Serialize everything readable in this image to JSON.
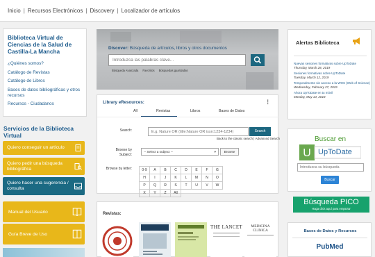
{
  "topnav": {
    "items": [
      "Inicio",
      "Recursos Electrónicos",
      "Discovery",
      "Localizador de artículos"
    ],
    "separator": "|"
  },
  "left": {
    "title": "Biblioteca Virtual de Ciencias de la Salud de Castilla-La Mancha",
    "links": [
      "¿Quiénes somos?",
      "Catálogo de Revistas",
      "Catálogo de Libros",
      "Bases de datos bibliográficas y otros recursos",
      "Recursos - Ciudadanos"
    ],
    "services_title": "Servicios de la Biblioteca Virtual",
    "services": [
      "Quiero conseguir un artículo",
      "Quiero pedir una búsqueda bibliográfica",
      "Quiero hacer una sugerencia / consulta"
    ],
    "manual": "Manual del Usuario",
    "guide": "Guía Breve de Uso"
  },
  "discover": {
    "label_bold": "Discover:",
    "label_rest": " Búsqueda de artículos, libros y otros documentos",
    "placeholder": "Introduzca las palabras clave...",
    "links": [
      "Búsqueda Avanzada",
      "Favoritos",
      "Búsquedas guardadas"
    ]
  },
  "eresources": {
    "title": "Library eResources:",
    "tabs": [
      "All",
      "Revistas",
      "Libros",
      "Bases de Datos"
    ],
    "active_tab": "Revistas",
    "search_label": "Search:",
    "search_placeholder": "E.g. Nature OR (title:Nature OR issn:1234-1234)",
    "search_button": "Search",
    "classic_link": "Back to the classic search",
    "advanced_link": "Advanced Search",
    "browse_subject_label": "Browse by Subject:",
    "select_subject": "-- Select a subject --",
    "browse_button": "Browse",
    "browse_letter_label": "Browse by letter:",
    "letters": [
      "0-9",
      "A",
      "B",
      "C",
      "D",
      "E",
      "F",
      "G",
      "H",
      "I",
      "J",
      "K",
      "L",
      "M",
      "N",
      "O",
      "P",
      "Q",
      "R",
      "S",
      "T",
      "U",
      "V",
      "W",
      "X",
      "Y",
      "Z",
      "All"
    ]
  },
  "revistas": {
    "label": "Revistas:",
    "covers": [
      "New England Journal of Medicine",
      "BMJ",
      "Journal",
      "The Lancet",
      "Medicina Clínica"
    ],
    "lancet_text": "THE LANCET",
    "medicina_text": "MEDICINA CLINICA"
  },
  "alerts": {
    "title": "Alertas Biblioteca",
    "items": [
      {
        "text": "Nuevas sesiones formativas sobre UpToDate",
        "date": "Thursday, March 28, 2019"
      },
      {
        "text": "Sesiones formativas sobre UpToDate",
        "date": "Tuesday, March 12, 2019"
      },
      {
        "text": "Temporalmente sin acceso a la WOS (Web of Science)",
        "date": "Wednesday, February 27, 2019"
      },
      {
        "text": "Ahora UpToDate en tu móvil",
        "date": "Monday, May 14, 2018"
      }
    ]
  },
  "uptodate": {
    "title": "Buscar en",
    "brand": "UpToDate",
    "placeholder": "Introduzca su búsqueda",
    "button": "Buscar"
  },
  "pico": {
    "title": "Búsqueda PICO",
    "subtitle": "Haga click aquí para empezar"
  },
  "bases": {
    "title": "Bases de Datos y Recursos",
    "pubmed": "PubMed"
  },
  "colors": {
    "brand_blue": "#1f5d8e",
    "yellow": "#e8b71a",
    "teal": "#1b6a83",
    "green": "#17a26d"
  }
}
